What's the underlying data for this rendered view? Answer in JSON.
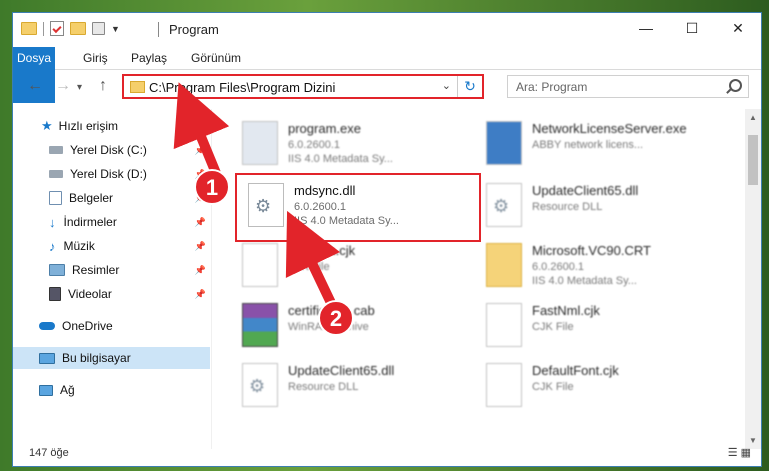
{
  "window": {
    "title": "Program",
    "minimize_icon": "minimize-icon",
    "maximize_icon": "maximize-icon",
    "close_icon": "close-icon"
  },
  "ribbon": {
    "tabs": [
      {
        "label": "Dosya"
      },
      {
        "label": "Giriş"
      },
      {
        "label": "Paylaş"
      },
      {
        "label": "Görünüm"
      }
    ]
  },
  "nav": {
    "address_path": "C:\\Program Files\\Program Dizini",
    "search_placeholder": "Ara: Program"
  },
  "sidebar": {
    "items": [
      {
        "label": "Hızlı erişim",
        "icon": "star-icon"
      },
      {
        "label": "Yerel Disk (C:)",
        "icon": "drive-icon"
      },
      {
        "label": "Yerel Disk (D:)",
        "icon": "drive-icon"
      },
      {
        "label": "Belgeler",
        "icon": "documents-icon"
      },
      {
        "label": "İndirmeler",
        "icon": "download-icon"
      },
      {
        "label": "Müzik",
        "icon": "music-icon"
      },
      {
        "label": "Resimler",
        "icon": "pictures-icon"
      },
      {
        "label": "Videolar",
        "icon": "videos-icon"
      },
      {
        "label": "OneDrive",
        "icon": "cloud-icon"
      },
      {
        "label": "Bu bilgisayar",
        "icon": "computer-icon"
      },
      {
        "label": "Ağ",
        "icon": "network-icon"
      }
    ]
  },
  "files": [
    {
      "name": "program.exe",
      "line2": "6.0.2600.1",
      "line3": "IIS 4.0 Metadata Sy..."
    },
    {
      "name": "NetworkLicenseServer.exe",
      "line2": "ABBY network licens...",
      "line3": ""
    },
    {
      "name": "mdsync.dll",
      "line2": "6.0.2600.1",
      "line3": "IIS 4.0 Metadata Sy..."
    },
    {
      "name": "UpdateClient65.dll",
      "line2": "Resource DLL",
      "line3": ""
    },
    {
      "name": "Rexsom.cjk",
      "line2": "CJK File",
      "line3": ""
    },
    {
      "name": "Microsoft.VC90.CRT",
      "line2": "6.0.2600.1",
      "line3": "IIS 4.0 Metadata Sy..."
    },
    {
      "name": "certificates.cab",
      "line2": "WinRAR archive",
      "line3": ""
    },
    {
      "name": "FastNml.cjk",
      "line2": "CJK File",
      "line3": ""
    },
    {
      "name": "UpdateClient65.dll",
      "line2": "Resource DLL",
      "line3": ""
    },
    {
      "name": "DefaultFont.cjk",
      "line2": "CJK File",
      "line3": ""
    }
  ],
  "annotations": {
    "step1": "1",
    "step2": "2",
    "arrow_color": "#e2242a"
  },
  "status": {
    "count": "147 öğe"
  }
}
